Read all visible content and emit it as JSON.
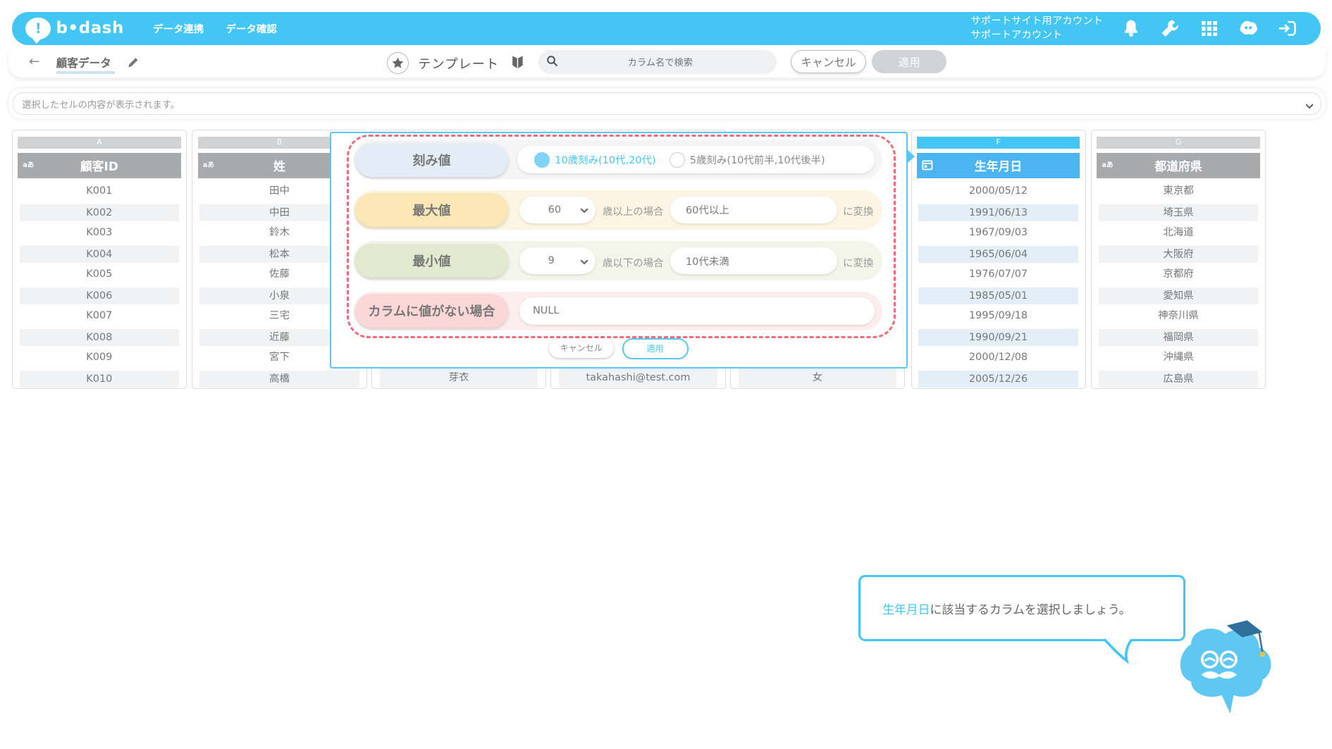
{
  "header": {
    "logo_text": "b•dash",
    "logo_mark": "!",
    "nav": [
      "データ連携",
      "データ確認"
    ],
    "account_line1": "サポートサイト用アカウント",
    "account_line2": "サポートアカウント",
    "icons": [
      "bell-icon",
      "wrench-icon",
      "grid-icon",
      "mascot-icon",
      "logout-icon"
    ],
    "accent_color": "#44c6f5"
  },
  "toolbar": {
    "back": "←",
    "page_title": "顧客データ",
    "template_label": "テンプレート",
    "search_placeholder": "カラム名で検索",
    "cancel_label": "キャンセル",
    "apply_label": "適用"
  },
  "cellbar": {
    "text": "選択したセルの内容が表示されます。"
  },
  "columns": [
    {
      "letter": "A",
      "type": "aあ",
      "header": "顧客ID",
      "cells": [
        "K001",
        "K002",
        "K003",
        "K004",
        "K005",
        "K006",
        "K007",
        "K008",
        "K009",
        "K010"
      ]
    },
    {
      "letter": "B",
      "type": "aあ",
      "header": "姓",
      "cells": [
        "田中",
        "中田",
        "鈴木",
        "松本",
        "佐藤",
        "小泉",
        "三宅",
        "近藤",
        "宮下",
        "高橋"
      ]
    },
    {
      "letter": "F",
      "type": "calendar",
      "header": "生年月日",
      "cells": [
        "2000/05/12",
        "1991/06/13",
        "1967/09/03",
        "1965/06/04",
        "1976/07/07",
        "1985/05/01",
        "1995/09/18",
        "1990/09/21",
        "2000/12/08",
        "2005/12/26"
      ]
    },
    {
      "letter": "G",
      "type": "aあ",
      "header": "都道府県",
      "cells": [
        "東京都",
        "埼玉県",
        "北海道",
        "大阪府",
        "京都府",
        "愛知県",
        "神奈川県",
        "福岡県",
        "沖縄県",
        "広島県"
      ]
    }
  ],
  "hidden_row_tail": [
    "芽衣",
    "takahashi@test.com",
    "女"
  ],
  "popup": {
    "step_label": "刻み値",
    "step_options": [
      "10歳刻み(10代,20代)",
      "5歳刻み(10代前半,10代後半)"
    ],
    "step_selected": 0,
    "max_label": "最大値",
    "max_value": "60",
    "max_condition": "歳以上の場合",
    "max_output": "60代以上",
    "min_label": "最小値",
    "min_value": "9",
    "min_condition": "歳以下の場合",
    "min_output": "10代未満",
    "convert_suffix": "に変換",
    "empty_label": "カラムに値がない場合",
    "empty_value": "NULL",
    "cancel_label": "キャンセル",
    "apply_label": "適用"
  },
  "tutorial": {
    "highlight": "生年月日",
    "message": "に該当するカラムを選択しましょう。"
  }
}
